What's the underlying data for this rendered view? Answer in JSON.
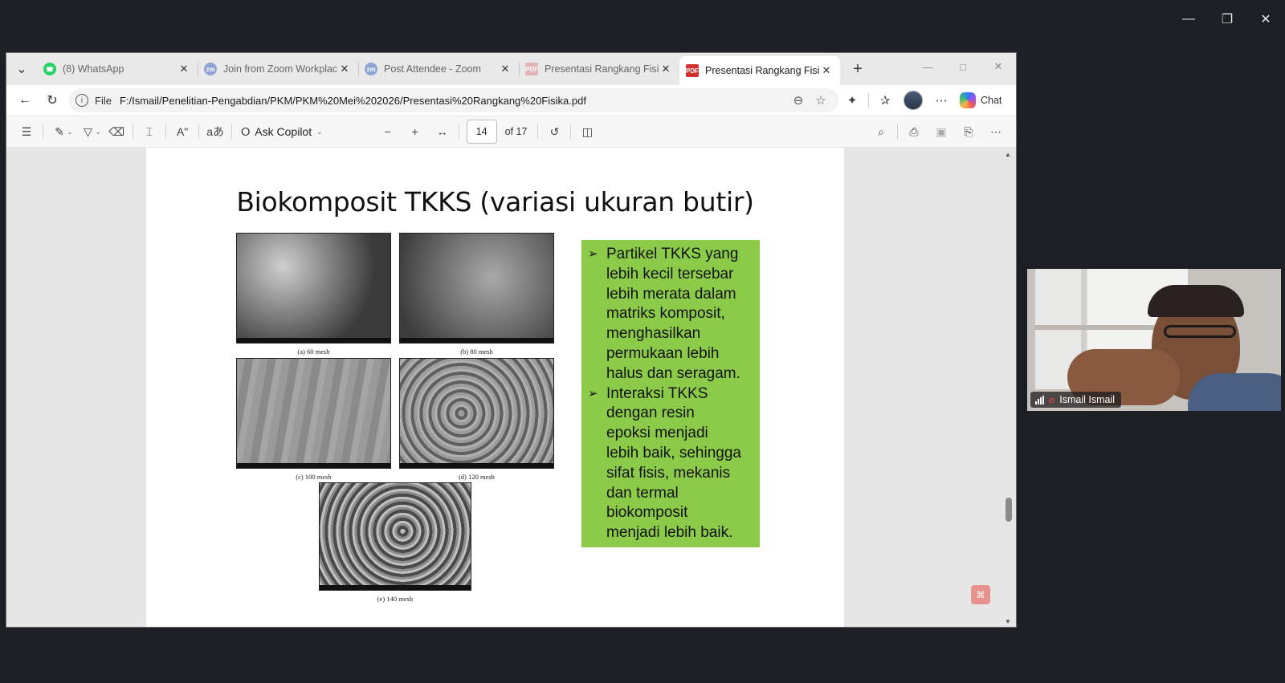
{
  "tabs": [
    {
      "title": "(8) WhatsApp",
      "favicon": "whatsapp-icon",
      "active": false
    },
    {
      "title": "Join from Zoom Workplace",
      "favicon": "zoom-icon",
      "active": false
    },
    {
      "title": "Post Attendee - Zoom",
      "favicon": "zoom-icon",
      "active": false
    },
    {
      "title": "Presentasi Rangkang Fisika.",
      "favicon": "pdf-icon",
      "active": false
    },
    {
      "title": "Presentasi Rangkang Fisika.",
      "favicon": "pdf-icon",
      "active": true
    }
  ],
  "address": {
    "scheme": "File",
    "url": "F:/Ismail/Penelitian-Pengabdian/PKM/PKM%20Mei%202026/Presentasi%20Rangkang%20Fisika.pdf"
  },
  "toolbar": {
    "copilot_label": "Chat"
  },
  "pdf_toolbar": {
    "ask_copilot": "Ask Copilot",
    "page_current": "14",
    "page_total": "of 17"
  },
  "slide": {
    "title": "Biokomposit TKKS (variasi ukuran butir)",
    "images": [
      {
        "caption": "(a) 60 mesh"
      },
      {
        "caption": "(b) 80 mesh"
      },
      {
        "caption": "(c) 100 mesh"
      },
      {
        "caption": "(d) 120 mesh"
      },
      {
        "caption": "(e) 140 mesh"
      }
    ],
    "bullets": [
      {
        "lines": [
          "Partikel TKKS yang",
          "lebih kecil tersebar",
          "lebih merata dalam",
          "matriks komposit,",
          "menghasilkan",
          "permukaan lebih",
          "halus dan seragam."
        ]
      },
      {
        "lines": [
          "Interaksi TKKS",
          "dengan resin",
          "epoksi menjadi",
          "lebih baik, sehingga",
          "sifat fisis, mekanis",
          "dan termal",
          "biokomposit",
          "menjadi lebih baik."
        ]
      }
    ],
    "box_color": "#8ccb4a"
  },
  "participant": {
    "name": "Ismail Ismail"
  }
}
